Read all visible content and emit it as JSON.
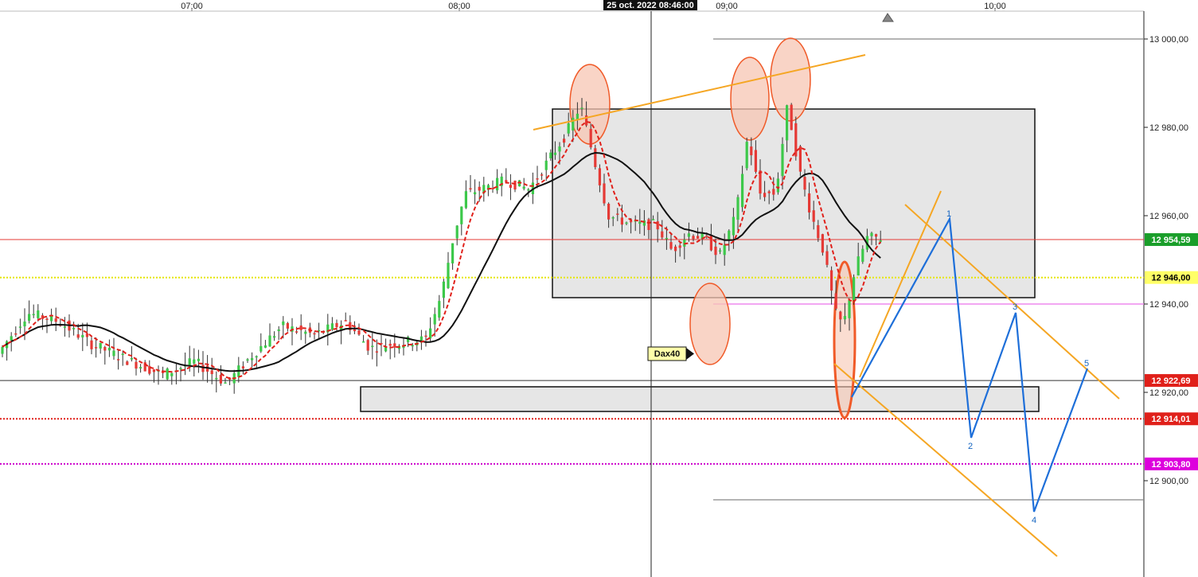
{
  "chart_data": {
    "type": "candlestick",
    "instrument_label": "Dax40",
    "crosshair_time_label": "25 oct. 2022 08:46:00",
    "time_labels": [
      "07:00",
      "08:00",
      "09:00",
      "10:00"
    ],
    "price_axis": {
      "ylim": [
        12897,
        13008
      ],
      "tick_labels": [
        "13 000,00",
        "12 980,00",
        "12 960,00",
        "12 940,00",
        "12 920,00",
        "12 900,00"
      ],
      "tick_values": [
        13000,
        12980,
        12960,
        12940,
        12920,
        12900
      ]
    },
    "horizontal_levels": [
      {
        "value": 12954.59,
        "label": "12 954,59",
        "color": "#e53935",
        "style": "solid",
        "badge_color": "#1a9e2a",
        "badge_text_color": "#ffffff"
      },
      {
        "value": 12946.0,
        "label": "12 946,00",
        "color": "#e6e600",
        "style": "dotted",
        "badge_color": "#ffff66",
        "badge_text_color": "#000000"
      },
      {
        "value": 12922.69,
        "label": "12 922,69",
        "color": "#333333",
        "style": "solid",
        "badge_color": "#e0201a",
        "badge_text_color": "#ffffff"
      },
      {
        "value": 12914.01,
        "label": "12 914,01",
        "color": "#e0201a",
        "style": "dotted",
        "badge_color": "#e0201a",
        "badge_text_color": "#ffffff"
      },
      {
        "value": 12903.8,
        "label": "12 903,80",
        "color": "#cc00cc",
        "style": "dotted",
        "badge_color": "#dd00dd",
        "badge_text_color": "#ffffff"
      }
    ],
    "wave_labels": [
      "1",
      "2",
      "3",
      "4",
      "5"
    ],
    "colors": {
      "bull": "#3cc84a",
      "bear": "#e53935",
      "ma_fast": "#e0201a",
      "ma_slow": "#111111",
      "trendline": "#f5a623",
      "wave": "#1e6fd9",
      "ellipse_fill": "#f7c6b3",
      "ellipse_stroke": "#f05a28",
      "zone_fill": "#e6e6e6"
    }
  }
}
